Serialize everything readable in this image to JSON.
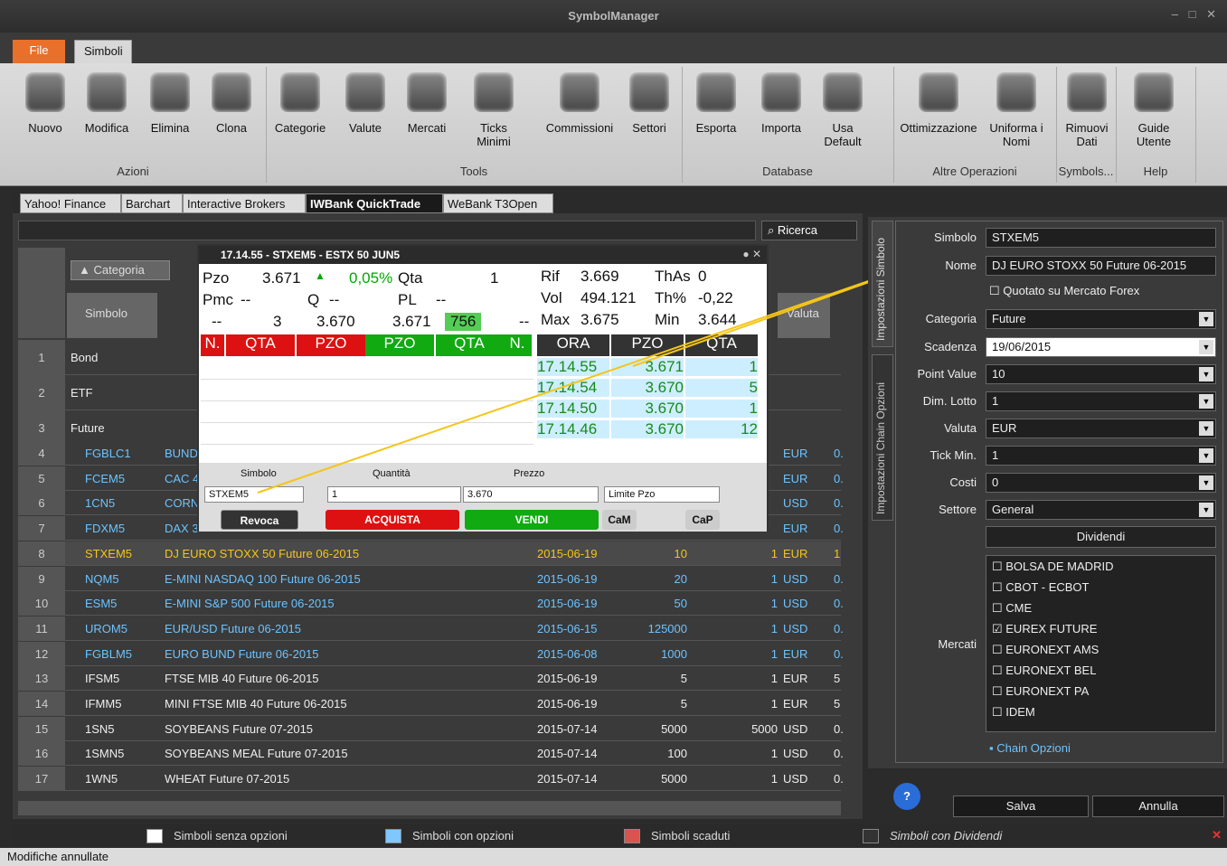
{
  "window": {
    "title": "SymbolManager",
    "controls": "– □ ✕"
  },
  "ribbon": {
    "tabs": [
      "File",
      "Simboli"
    ],
    "buttons": [
      "Nuovo",
      "Modifica",
      "Elimina",
      "Clona",
      "Categorie",
      "Valute",
      "Mercati",
      "Ticks Minimi",
      "Commissioni",
      "Settori",
      "Esporta",
      "Importa",
      "Usa Default",
      "Ottimizzazione",
      "Uniforma i Nomi",
      "Rimuovi Dati",
      "Guide Utente"
    ],
    "groups": [
      "Azioni",
      "Tools",
      "Database",
      "Altre Operazioni",
      "Symbols...",
      "Help"
    ]
  },
  "tabs": [
    "Yahoo! Finance",
    "Barchart",
    "Interactive Brokers",
    "IWBank QuickTrade",
    "WeBank T3Open"
  ],
  "grid": {
    "search": "Ricerca",
    "headers": {
      "categoria": "Categoria",
      "simbolo": "Simbolo",
      "valuta": "Valuta"
    },
    "groups": [
      {
        "n": "1",
        "label": "Bond"
      },
      {
        "n": "2",
        "label": "ETF"
      },
      {
        "n": "3",
        "label": "Future"
      }
    ],
    "rows": [
      {
        "n": "4",
        "sym": "FGBLC1",
        "desc": "BUND",
        "date": "",
        "pv": "",
        "lot": "",
        "cur": "EUR",
        "x": "0."
      },
      {
        "n": "5",
        "sym": "FCEM5",
        "desc": "CAC 4",
        "date": "",
        "pv": "",
        "lot": "",
        "cur": "EUR",
        "x": "0."
      },
      {
        "n": "6",
        "sym": "1CN5",
        "desc": "CORN",
        "date": "",
        "pv": "",
        "lot": "",
        "cur": "USD",
        "x": "0."
      },
      {
        "n": "7",
        "sym": "FDXM5",
        "desc": "DAX 3",
        "date": "",
        "pv": "",
        "lot": "",
        "cur": "EUR",
        "x": "0."
      },
      {
        "n": "8",
        "sym": "STXEM5",
        "desc": "DJ EURO STOXX 50 Future 06-2015",
        "date": "2015-06-19",
        "pv": "10",
        "lot": "1",
        "cur": "EUR",
        "x": "1"
      },
      {
        "n": "9",
        "sym": "NQM5",
        "desc": "E-MINI NASDAQ 100 Future 06-2015",
        "date": "2015-06-19",
        "pv": "20",
        "lot": "1",
        "cur": "USD",
        "x": "0."
      },
      {
        "n": "10",
        "sym": "ESM5",
        "desc": "E-MINI S&P 500 Future 06-2015",
        "date": "2015-06-19",
        "pv": "50",
        "lot": "1",
        "cur": "USD",
        "x": "0."
      },
      {
        "n": "11",
        "sym": "UROM5",
        "desc": "EUR/USD Future 06-2015",
        "date": "2015-06-15",
        "pv": "125000",
        "lot": "1",
        "cur": "USD",
        "x": "0."
      },
      {
        "n": "12",
        "sym": "FGBLM5",
        "desc": "EURO BUND Future 06-2015",
        "date": "2015-06-08",
        "pv": "1000",
        "lot": "1",
        "cur": "EUR",
        "x": "0."
      },
      {
        "n": "13",
        "sym": "IFSM5",
        "desc": "FTSE MIB 40 Future 06-2015",
        "date": "2015-06-19",
        "pv": "5",
        "lot": "1",
        "cur": "EUR",
        "x": "5"
      },
      {
        "n": "14",
        "sym": "IFMM5",
        "desc": "MINI FTSE MIB 40 Future 06-2015",
        "date": "2015-06-19",
        "pv": "5",
        "lot": "1",
        "cur": "EUR",
        "x": "5"
      },
      {
        "n": "15",
        "sym": "1SN5",
        "desc": "SOYBEANS Future 07-2015",
        "date": "2015-07-14",
        "pv": "5000",
        "lot": "5000",
        "cur": "USD",
        "x": "0."
      },
      {
        "n": "16",
        "sym": "1SMN5",
        "desc": "SOYBEANS MEAL Future 07-2015",
        "date": "2015-07-14",
        "pv": "100",
        "lot": "1",
        "cur": "USD",
        "x": "0."
      },
      {
        "n": "17",
        "sym": "1WN5",
        "desc": "WHEAT Future 07-2015",
        "date": "2015-07-14",
        "pv": "5000",
        "lot": "1",
        "cur": "USD",
        "x": "0."
      }
    ]
  },
  "popup": {
    "title": "17.14.55 - STXEM5 - ESTX 50 JUN5",
    "pzo_l": "Pzo",
    "pzo": "3.671",
    "chg": "0,05%",
    "qta_l": "Qta",
    "qta": "1",
    "pmc_l": "Pmc",
    "pmc": "--",
    "q_l": "Q",
    "q": "--",
    "pl_l": "PL",
    "pl": "--",
    "rif_l": "Rif",
    "rif": "3.669",
    "thas_l": "ThAs",
    "thas": "0",
    "vol_l": "Vol",
    "vol": "494.121",
    "thp_l": "Th%",
    "thp": "-0,22",
    "max_l": "Max",
    "max": "3.675",
    "min_l": "Min",
    "min": "3.644",
    "book": {
      "n1": "--",
      "q1": "3",
      "p1": "3.670",
      "p2": "3.671",
      "q2": "756",
      "n2": "--"
    },
    "bookhdr": [
      "N.",
      "QTA",
      "PZO",
      "PZO",
      "QTA",
      "N."
    ],
    "tradehdr": [
      "ORA",
      "PZO",
      "QTA"
    ],
    "trades": [
      [
        "17.14.55",
        "3.671",
        "1"
      ],
      [
        "17.14.54",
        "3.670",
        "5"
      ],
      [
        "17.14.50",
        "3.670",
        "1"
      ],
      [
        "17.14.46",
        "3.670",
        "12"
      ]
    ],
    "simbolo_l": "Simbolo",
    "quantita_l": "Quantità",
    "prezzo_l": "Prezzo",
    "simbolo": "STXEM5",
    "quantita": "1",
    "prezzo": "3.670",
    "tipo": "Limite Pzo",
    "revoca": "Revoca",
    "acquista": "ACQUISTA",
    "vendi": "VENDI",
    "cam": "CaM",
    "cap": "CaP"
  },
  "form": {
    "tab1": "Impostazioni Simbolo",
    "tab2": "Impostazioni Chain Opzioni",
    "simbolo_l": "Simbolo",
    "simbolo": "STXEM5",
    "nome_l": "Nome",
    "nome": "DJ EURO STOXX 50 Future 06-2015",
    "forex": "Quotato su Mercato Forex",
    "categoria_l": "Categoria",
    "categoria": "Future",
    "scadenza_l": "Scadenza",
    "scadenza": "19/06/2015",
    "pv_l": "Point Value",
    "pv": "10",
    "lotto_l": "Dim. Lotto",
    "lotto": "1",
    "valuta_l": "Valuta",
    "valuta": "EUR",
    "tick_l": "Tick Min.",
    "tick": "1",
    "costi_l": "Costi",
    "costi": "0",
    "settore_l": "Settore",
    "settore": "General",
    "dividendi": "Dividendi",
    "mercati_l": "Mercati",
    "mercati": [
      {
        "n": "BOLSA DE MADRID",
        "c": false
      },
      {
        "n": "CBOT - ECBOT",
        "c": false
      },
      {
        "n": "CME",
        "c": false
      },
      {
        "n": "EUREX FUTURE",
        "c": true
      },
      {
        "n": "EURONEXT AMS",
        "c": false
      },
      {
        "n": "EURONEXT BEL",
        "c": false
      },
      {
        "n": "EURONEXT PA",
        "c": false
      },
      {
        "n": "IDEM",
        "c": false
      }
    ],
    "chain": "Chain Opzioni",
    "salva": "Salva",
    "annulla": "Annulla"
  },
  "legend": [
    "Simboli senza opzioni",
    "Simboli con opzioni",
    "Simboli scaduti",
    "Simboli con Dividendi"
  ],
  "status": "Modifiche annullate"
}
